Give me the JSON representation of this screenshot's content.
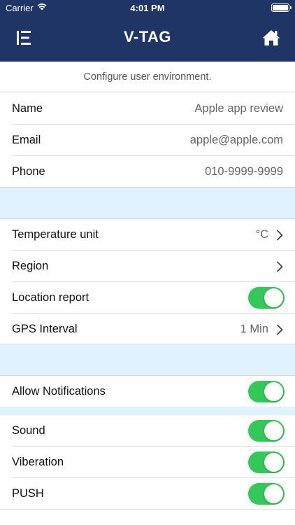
{
  "status_bar": {
    "carrier": "Carrier",
    "time": "4:01 PM"
  },
  "nav": {
    "title": "V-TAG",
    "left_icon": "menu-icon",
    "right_icon": "home-icon"
  },
  "caption": "Configure user environment.",
  "profile": [
    {
      "label": "Name",
      "value": "Apple app review"
    },
    {
      "label": "Email",
      "value": "apple@apple.com"
    },
    {
      "label": "Phone",
      "value": "010-9999-9999"
    }
  ],
  "settings": [
    {
      "label": "Temperature unit",
      "value": "°C",
      "chevron": true
    },
    {
      "label": "Region",
      "value": "",
      "chevron": true
    },
    {
      "label": "Location report",
      "toggle": true
    },
    {
      "label": "GPS Interval",
      "value": "1 Min",
      "chevron": true
    }
  ],
  "notifications": {
    "allow_label": "Allow Notifications",
    "allow_on": true,
    "items": [
      {
        "label": "Sound",
        "on": true
      },
      {
        "label": "Viberation",
        "on": true
      },
      {
        "label": "PUSH",
        "on": true
      }
    ]
  },
  "colors": {
    "header_bg": "#1f3566",
    "toggle_on": "#34c759",
    "section_bg": "#e0f2fd"
  }
}
